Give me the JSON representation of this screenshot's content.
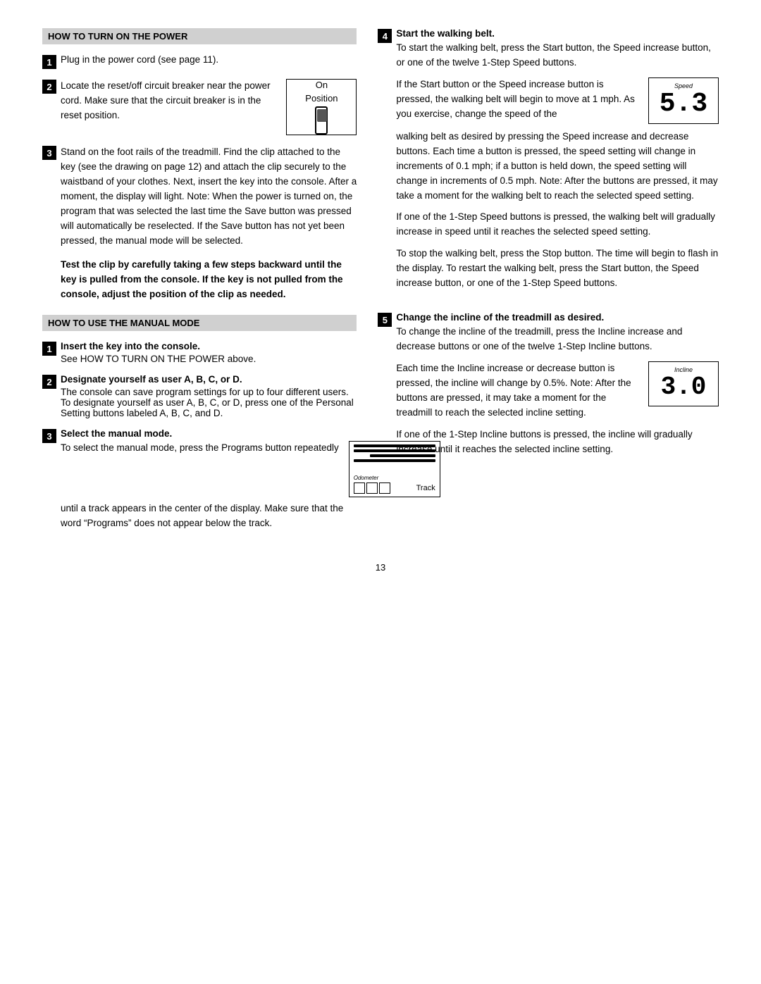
{
  "page": {
    "number": "13"
  },
  "left": {
    "section1": {
      "heading": "HOW TO TURN ON THE POWER",
      "step1": {
        "num": "1",
        "text": "Plug in the power cord (see page 11)."
      },
      "step2": {
        "num": "2",
        "text_part1": "Locate the reset/off circuit breaker near the power cord. Make sure that the circuit breaker is in the reset position.",
        "on_label": "On",
        "position_label": "Position"
      },
      "step3": {
        "num": "3",
        "text": "Stand on the foot rails of the treadmill. Find the clip attached to the key (see the drawing on page 12) and attach the clip securely to the waistband of your clothes. Next, insert the key into the console. After a moment, the display will light. Note: When the power is turned on, the program that was selected the last time the Save button was pressed will automatically be reselected. If the Save button has not yet been pressed, the manual mode will be selected."
      },
      "warning": {
        "text": "Test the clip by carefully taking a few steps backward until the key is pulled from the console. If the key is not pulled from the console, adjust the position of the clip as needed."
      }
    },
    "section2": {
      "heading": "HOW TO USE THE MANUAL MODE",
      "step1": {
        "num": "1",
        "title": "Insert the key into the console.",
        "text": "See HOW TO TURN ON THE POWER above."
      },
      "step2": {
        "num": "2",
        "title": "Designate yourself as user A, B, C, or D.",
        "text": "The console can save program settings for up to four different users. To designate yourself as user A, B, C, or D, press one of the Personal Setting buttons labeled A, B, C, and D."
      },
      "step3": {
        "num": "3",
        "title": "Select the manual mode.",
        "text_before": "To select the manual mode, press the Programs button repeatedly",
        "text_after": "until a track appears in the center of the display. Make sure that the word “Programs” does not appear below the track.",
        "odometer_label": "Odometer",
        "track_label": "Track"
      }
    }
  },
  "right": {
    "step4": {
      "num": "4",
      "title": "Start the walking belt.",
      "para1": "To start the walking belt, press the Start button, the Speed increase button, or one of the twelve 1-Step Speed buttons.",
      "para2": "If the Start button or the Speed increase button is pressed, the walking belt will begin to move at 1 mph. As you exercise, change the speed of the",
      "para3": "walking belt as desired by pressing the Speed increase and decrease buttons. Each time a button is pressed, the speed setting will change in increments of 0.1 mph; if a button is held down, the speed setting will change in increments of 0.5 mph. Note: After the buttons are pressed, it may take a moment for the walking belt to reach the selected speed setting.",
      "para4": "If one of the 1-Step Speed buttons is pressed, the walking belt will gradually increase in speed until it reaches the selected speed setting.",
      "para5": "To stop the walking belt, press the Stop button. The time will begin to flash in the display. To restart the walking belt, press the Start button, the Speed increase button, or one of the 1-Step Speed buttons.",
      "speed_label": "Speed",
      "speed_value": "5.3"
    },
    "step5": {
      "num": "5",
      "title": "Change the incline of the treadmill as desired.",
      "para1": "To change the incline of the treadmill, press the Incline increase and decrease buttons or one of the twelve 1-Step Incline buttons.",
      "para2_col1": "Each time the Incline increase or decrease button is pressed, the incline will change by 0.5%. Note: After the buttons are pressed, it may take a moment for the treadmill to reach the selected incline setting.",
      "para3": "If one of the 1-Step Incline buttons is pressed, the incline will gradually increase until it reaches the selected incline setting.",
      "incline_label": "Incline",
      "incline_value": "3.0"
    }
  }
}
